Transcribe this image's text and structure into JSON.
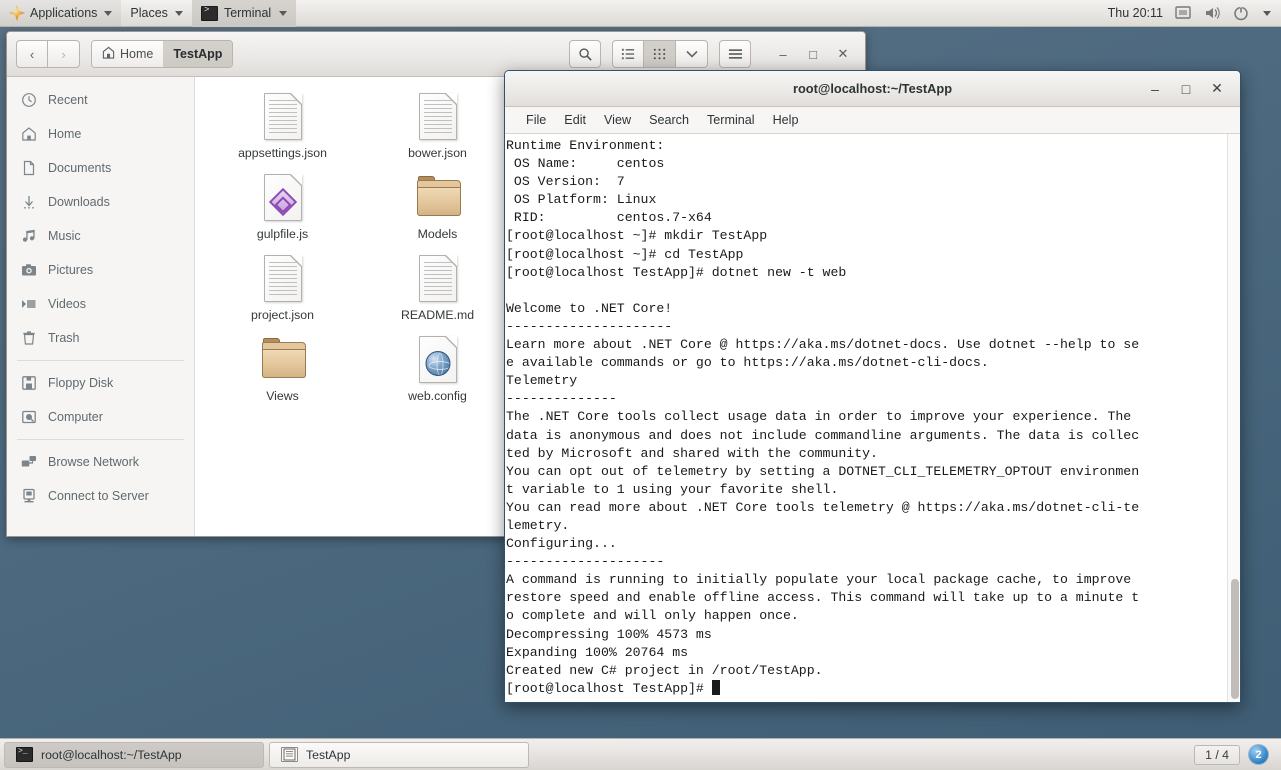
{
  "top_panel": {
    "applications_label": "Applications",
    "places_label": "Places",
    "active_window_label": "Terminal",
    "clock": "Thu 20:11",
    "tray": [
      "display-icon",
      "volume-icon",
      "power-icon",
      "chevron-down-icon"
    ]
  },
  "file_manager": {
    "nav": {
      "back": "‹",
      "forward": "›"
    },
    "breadcrumb": [
      {
        "label": "Home",
        "icon": "home-icon",
        "current": false
      },
      {
        "label": "TestApp",
        "icon": "",
        "current": true
      }
    ],
    "toolbar": {
      "search": "⌕",
      "list_view": "list-view-icon",
      "grid_view": "grid-view-icon",
      "view_dropdown": "⌄",
      "menu": "hamburger-menu-icon",
      "minimize": "–",
      "maximize": "□",
      "close": "✕"
    },
    "sidebar": [
      {
        "label": "Recent",
        "icon": "clock-icon"
      },
      {
        "label": "Home",
        "icon": "home-icon"
      },
      {
        "label": "Documents",
        "icon": "document-icon"
      },
      {
        "label": "Downloads",
        "icon": "download-arrow-icon"
      },
      {
        "label": "Music",
        "icon": "music-note-icon"
      },
      {
        "label": "Pictures",
        "icon": "camera-icon"
      },
      {
        "label": "Videos",
        "icon": "video-icon"
      },
      {
        "label": "Trash",
        "icon": "trash-icon"
      },
      {
        "label": "Floppy Disk",
        "icon": "floppy-disk-icon"
      },
      {
        "label": "Computer",
        "icon": "computer-icon"
      },
      {
        "label": "Browse Network",
        "icon": "network-icon"
      },
      {
        "label": "Connect to Server",
        "icon": "server-icon"
      }
    ],
    "files": [
      {
        "name": "appsettings.json",
        "type": "document"
      },
      {
        "name": "bower.json",
        "type": "document"
      },
      {
        "name": "gulpfile.js",
        "type": "gulp"
      },
      {
        "name": "Models",
        "type": "folder"
      },
      {
        "name": "project.json",
        "type": "document"
      },
      {
        "name": "README.md",
        "type": "document"
      },
      {
        "name": "Views",
        "type": "folder"
      },
      {
        "name": "web.config",
        "type": "web"
      }
    ]
  },
  "terminal": {
    "title": "root@localhost:~/TestApp",
    "window_controls": {
      "minimize": "–",
      "maximize": "□",
      "close": "✕"
    },
    "menus": [
      "File",
      "Edit",
      "View",
      "Search",
      "Terminal",
      "Help"
    ],
    "output": "Runtime Environment:\n OS Name:     centos\n OS Version:  7\n OS Platform: Linux\n RID:         centos.7-x64\n[root@localhost ~]# mkdir TestApp\n[root@localhost ~]# cd TestApp\n[root@localhost TestApp]# dotnet new -t web\n\nWelcome to .NET Core!\n---------------------\nLearn more about .NET Core @ https://aka.ms/dotnet-docs. Use dotnet --help to se\ne available commands or go to https://aka.ms/dotnet-cli-docs.\nTelemetry\n--------------\nThe .NET Core tools collect usage data in order to improve your experience. The\ndata is anonymous and does not include commandline arguments. The data is collec\nted by Microsoft and shared with the community.\nYou can opt out of telemetry by setting a DOTNET_CLI_TELEMETRY_OPTOUT environmen\nt variable to 1 using your favorite shell.\nYou can read more about .NET Core tools telemetry @ https://aka.ms/dotnet-cli-te\nlemetry.\nConfiguring...\n--------------------\nA command is running to initially populate your local package cache, to improve\nrestore speed and enable offline access. This command will take up to a minute t\no complete and will only happen once.\nDecompressing 100% 4573 ms\nExpanding 100% 20764 ms\nCreated new C# project in /root/TestApp.\n",
    "prompt": "[root@localhost TestApp]# "
  },
  "taskbar": {
    "tasks": [
      {
        "label": "root@localhost:~/TestApp",
        "icon": "terminal-icon",
        "active": true
      },
      {
        "label": "TestApp",
        "icon": "file-manager-icon",
        "active": false
      }
    ],
    "workspace": "1 / 4",
    "notification_count": "2"
  }
}
